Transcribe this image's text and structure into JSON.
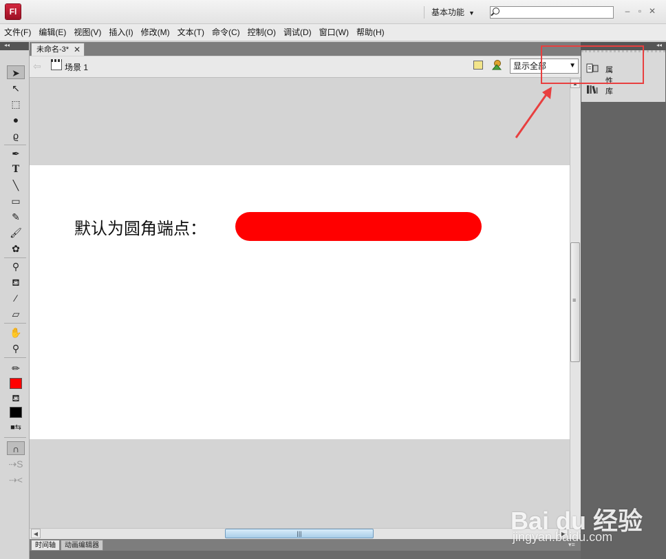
{
  "app": {
    "logo_text": "Fl",
    "workspace_label": "基本功能",
    "search": {
      "value": "",
      "placeholder": ""
    }
  },
  "menu": [
    "文件(F)",
    "编辑(E)",
    "视图(V)",
    "插入(I)",
    "修改(M)",
    "文本(T)",
    "命令(C)",
    "控制(O)",
    "调试(D)",
    "窗口(W)",
    "帮助(H)"
  ],
  "document": {
    "tab_title": "未命名-3*",
    "scene_label": "场景 1",
    "zoom_value": "显示全部"
  },
  "stage": {
    "text": "默认为圆角端点：",
    "shape_color": "#ff0000"
  },
  "bottom_tabs": [
    "时间轴",
    "动画编辑器"
  ],
  "right_panel": {
    "items": [
      {
        "label": "属性",
        "icon": "properties-icon"
      },
      {
        "label": "库",
        "icon": "library-icon"
      }
    ]
  },
  "tools": {
    "stroke_color": "#ff0000",
    "fill_color": "#000000",
    "icons": [
      "selection-tool-icon",
      "subselection-tool-icon",
      "free-transform-tool-icon",
      "3d-rotation-tool-icon",
      "lasso-tool-icon",
      "pen-tool-icon",
      "text-tool-icon",
      "line-tool-icon",
      "rectangle-tool-icon",
      "pencil-tool-icon",
      "brush-tool-icon",
      "deco-tool-icon",
      "bone-tool-icon",
      "paint-bucket-tool-icon",
      "eyedropper-tool-icon",
      "eraser-tool-icon",
      "hand-tool-icon",
      "zoom-tool-icon"
    ]
  },
  "annotation": {
    "color": "#e83f3f"
  },
  "watermark": {
    "brand": "Bai du 经验",
    "url": "jingyan.baidu.com"
  }
}
